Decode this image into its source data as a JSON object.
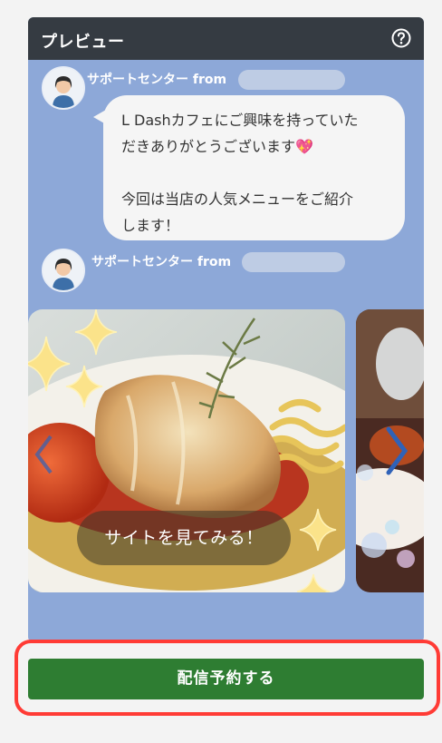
{
  "colors": {
    "header_bg": "#353b42",
    "chat_bg": "#8da8d8",
    "bubble_bg": "#f5f5f5",
    "button_bg": "#2e7d32",
    "highlight": "#ff3b35"
  },
  "header": {
    "title": "プレビュー",
    "help_icon": "question-circle-icon"
  },
  "messages": [
    {
      "sender": "サポートセンター from",
      "text_lines": [
        "L Dashカフェにご興味を持っていた",
        "だきありがとうございます💖",
        "",
        "今回は当店の人気メニューをご紹介",
        "します！"
      ]
    },
    {
      "sender": "サポートセンター from"
    }
  ],
  "carousel": {
    "cards": [
      {
        "button_label": "サイトを見てみる！"
      },
      {}
    ],
    "next_icon": "chevron-right-icon"
  },
  "footer": {
    "schedule_button_label": "配信予約する"
  }
}
